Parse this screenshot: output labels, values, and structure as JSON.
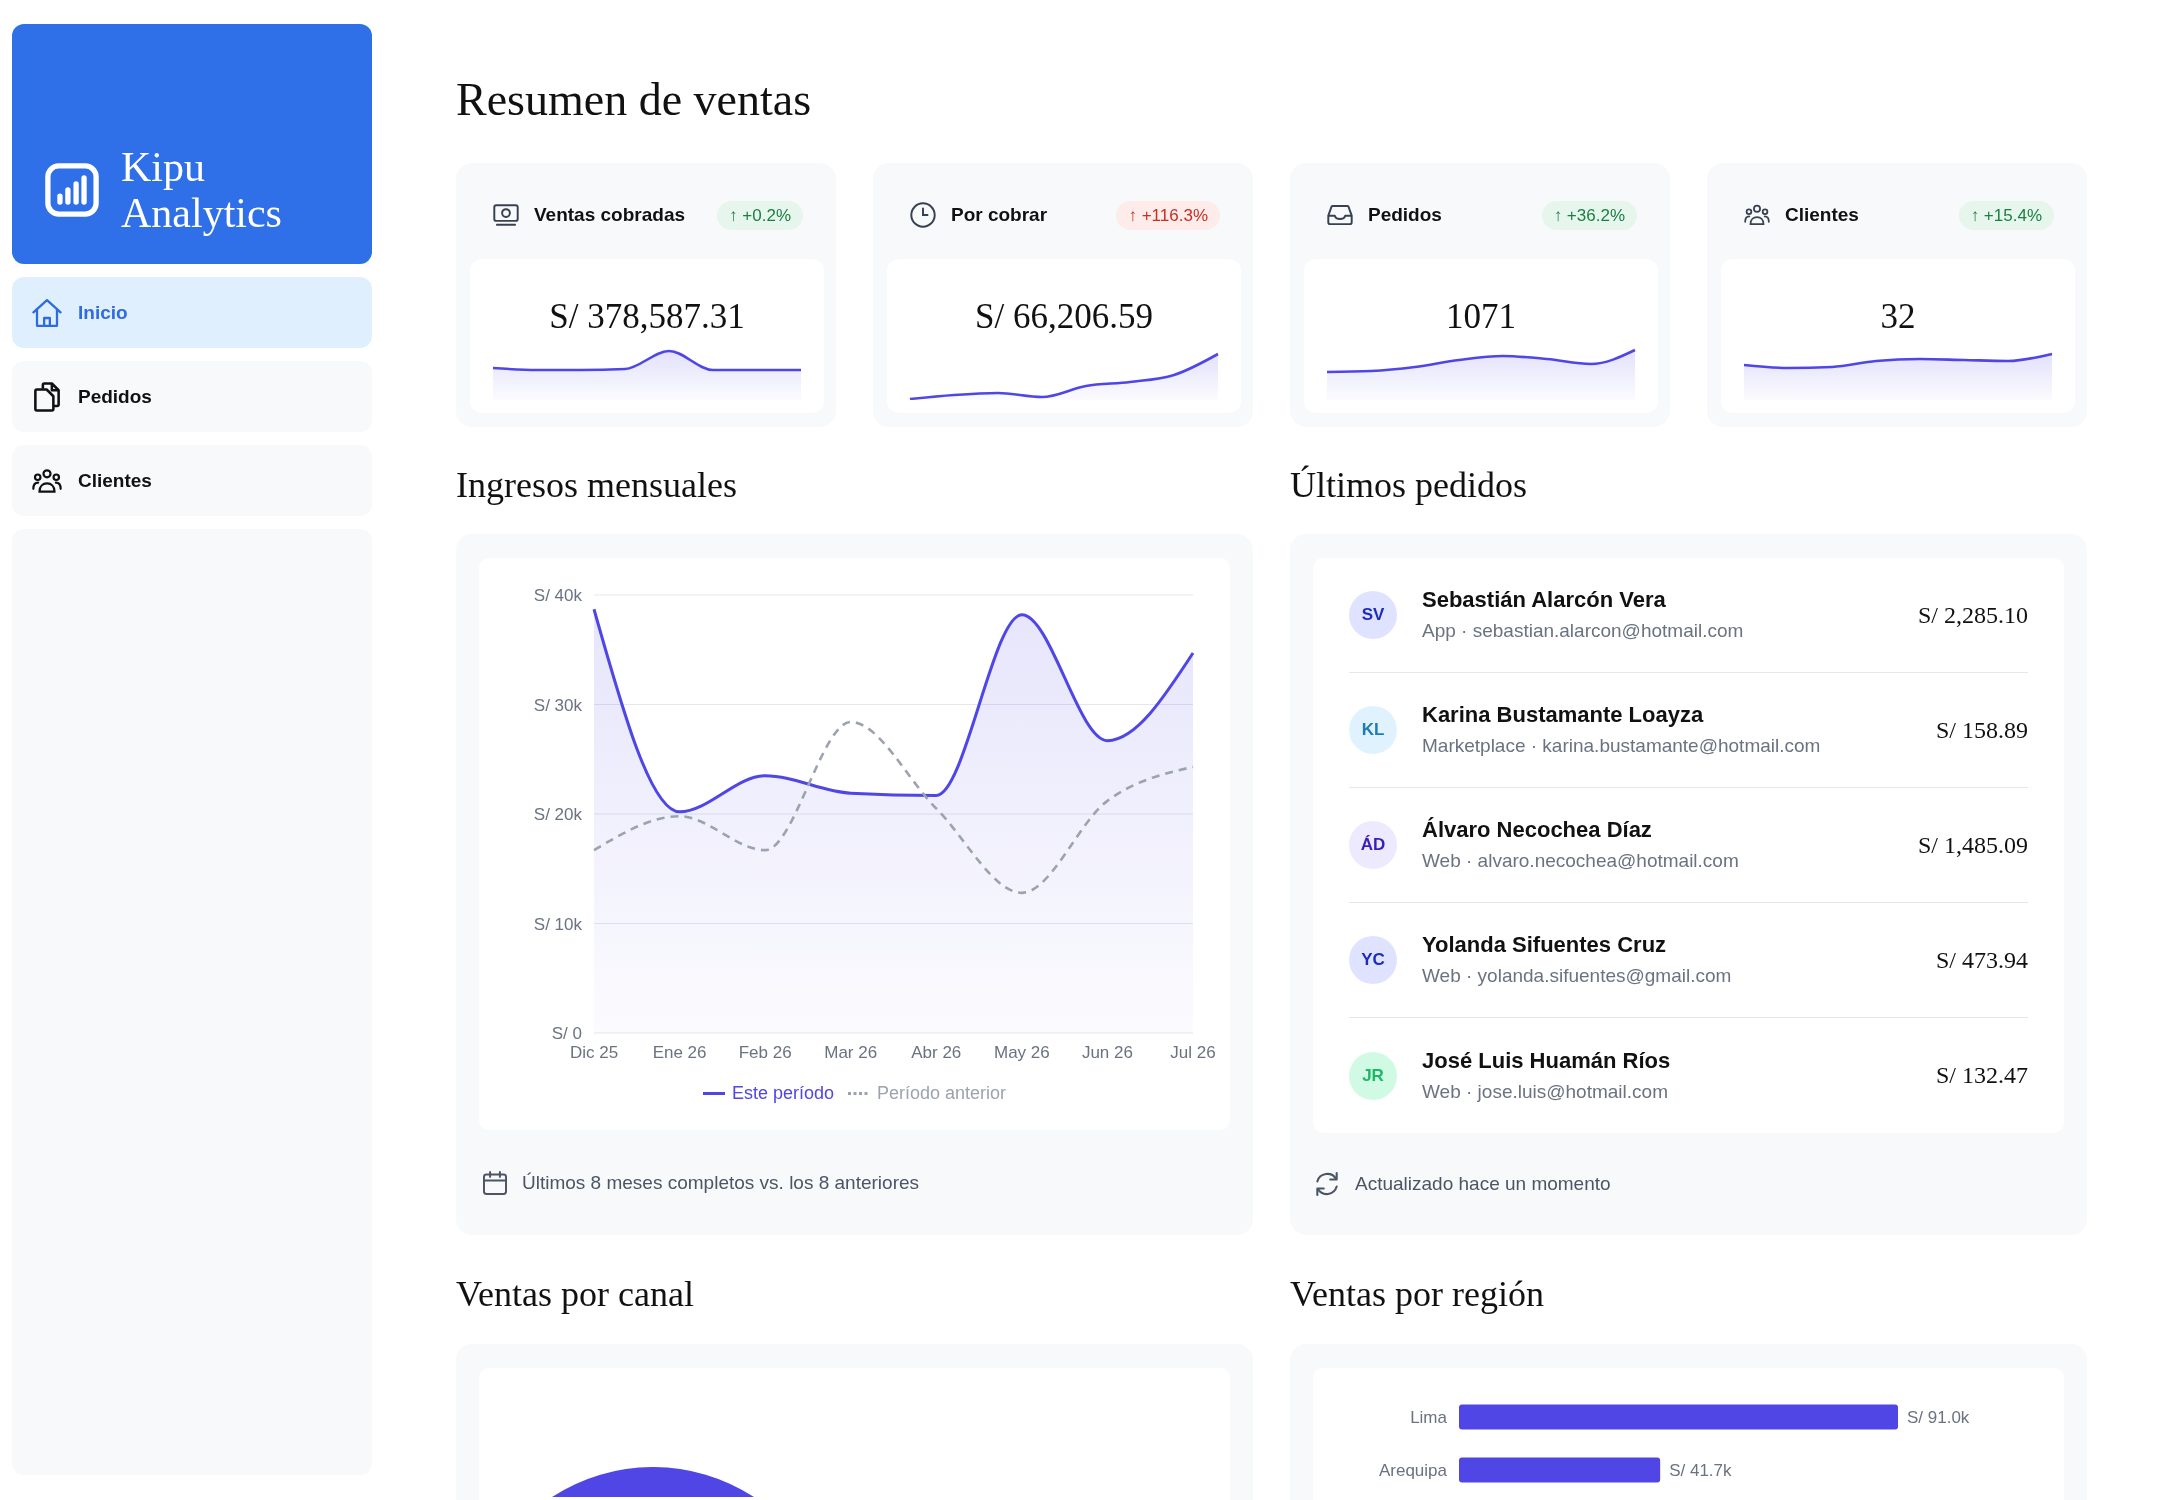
{
  "sidebar": {
    "brand": "Kipu Analytics",
    "nav_items": [
      {
        "label": "Inicio",
        "selected": true
      },
      {
        "label": "Pedidos",
        "selected": false
      },
      {
        "label": "Clientes",
        "selected": false
      }
    ]
  },
  "summary": {
    "title": "Resumen de ventas",
    "kpis": [
      {
        "label": "Ventas cobradas",
        "change": "↑ +0.2%",
        "favorable": true,
        "value": "S/ 378,587.31"
      },
      {
        "label": "Por cobrar",
        "change": "↑ +116.3%",
        "favorable": false,
        "value": "S/ 66,206.59"
      },
      {
        "label": "Pedidos",
        "change": "↑ +36.2%",
        "favorable": true,
        "value": "1071"
      },
      {
        "label": "Clientes",
        "change": "↑ +15.4%",
        "favorable": true,
        "value": "32"
      }
    ]
  },
  "monthly_revenue": {
    "title": "Ingresos mensuales",
    "chart_data": {
      "type": "line",
      "categories": [
        "Dic 25",
        "Ene 26",
        "Feb 26",
        "Mar 26",
        "Abr 26",
        "May 26",
        "Jun 26",
        "Jul 26"
      ],
      "series": [
        {
          "name": "Este período",
          "type": "area",
          "color": "#4f46e5",
          "line_style": "solid",
          "values": [
            38700,
            20200,
            23500,
            21900,
            21700,
            38200,
            26700,
            34700
          ]
        },
        {
          "name": "Período anterior",
          "type": "line",
          "color": "#9ca3af",
          "line_style": "dashed",
          "values": [
            16700,
            19800,
            16700,
            28400,
            20500,
            12800,
            21200,
            24300
          ]
        }
      ],
      "ylim": [
        0,
        40000
      ],
      "yticks": [
        {
          "value": 0,
          "label": "S/ 0"
        },
        {
          "value": 10000,
          "label": "S/ 10k"
        },
        {
          "value": 20000,
          "label": "S/ 20k"
        },
        {
          "value": 30000,
          "label": "S/ 30k"
        },
        {
          "value": 40000,
          "label": "S/ 40k"
        }
      ],
      "grid": true,
      "legend": "bottom"
    },
    "footnote": "Últimos 8 meses completos vs. los 8 anteriores"
  },
  "latest_orders": {
    "title": "Últimos pedidos",
    "orders": [
      {
        "initials": "SV",
        "color": "#e0e3ff",
        "name": "Sebastián Alarcón Vera",
        "detail": "App · sebastian.alarcon@hotmail.com",
        "amount": "S/ 2,285.10"
      },
      {
        "initials": "KL",
        "color": "#e0f2fe",
        "name": "Karina Bustamante Loayza",
        "detail": "Marketplace · karina.bustamante@hotmail.com",
        "amount": "S/ 158.89"
      },
      {
        "initials": "ÁD",
        "color": "#ede9fe",
        "name": "Álvaro Necochea Díaz",
        "detail": "Web · alvaro.necochea@hotmail.com",
        "amount": "S/ 1,485.09"
      },
      {
        "initials": "YC",
        "color": "#e0e3ff",
        "name": "Yolanda Sifuentes Cruz",
        "detail": "Web · yolanda.sifuentes@gmail.com",
        "amount": "S/ 473.94"
      },
      {
        "initials": "JR",
        "color": "#d1fae5",
        "name": "José Luis Huamán Ríos",
        "detail": "Web · jose.luis@hotmail.com",
        "amount": "S/ 132.47"
      }
    ],
    "footnote": "Actualizado hace un momento"
  },
  "sales_by_channel": {
    "title": "Ventas por canal"
  },
  "sales_by_region": {
    "title": "Ventas por región",
    "chart_data": {
      "type": "bar",
      "orientation": "horizontal",
      "categories": [
        "Lima",
        "Arequipa"
      ],
      "values": [
        91000,
        41700
      ],
      "value_labels": [
        "S/ 91.0k",
        "S/ 41.7k"
      ]
    }
  }
}
